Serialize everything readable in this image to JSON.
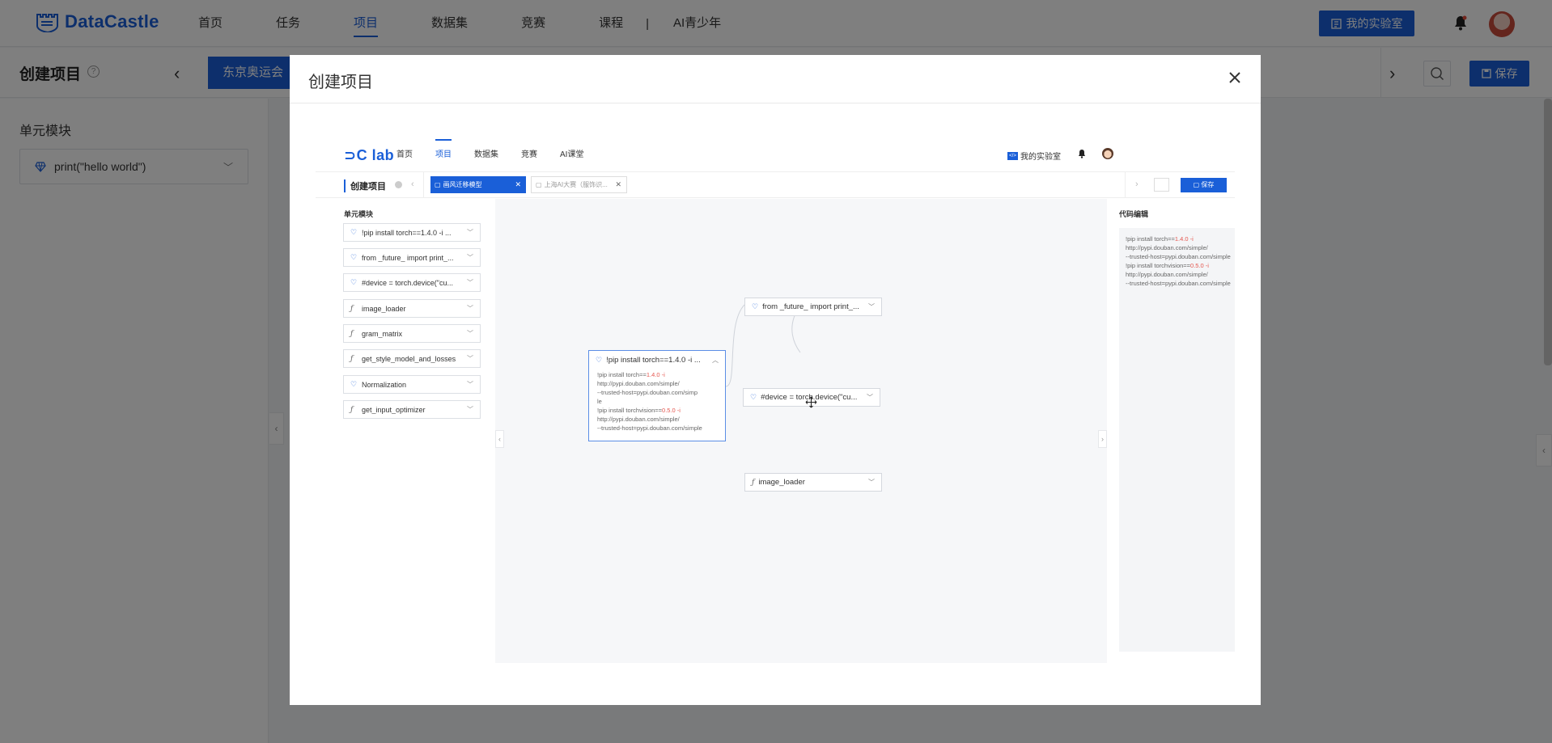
{
  "app": {
    "logo": "DataCastle",
    "nav": [
      "首页",
      "任务",
      "项目",
      "数据集",
      "竞赛",
      "课程"
    ],
    "nav_active": "项目",
    "nav_separator": "|",
    "nav_extra": "AI青少年",
    "lab_button": "我的实验室"
  },
  "subbar": {
    "title": "创建项目",
    "help": "?",
    "tab_label": "东京奥运会",
    "save_label": "保存"
  },
  "left_panel": {
    "label": "单元模块",
    "module": "print(\"hello world\")"
  },
  "modal": {
    "title": "创建项目",
    "preview": {
      "logo": "lab",
      "nav": [
        "首页",
        "项目",
        "数据集",
        "竞赛",
        "AI课堂"
      ],
      "nav_active": "项目",
      "lab_label": "我的实验室",
      "sub_title": "创建项目",
      "tab1": "画风迁移模型",
      "tab2": "上海AI大赛（服饰识...",
      "save_label": "保存",
      "modules_label": "单元模块",
      "modules": [
        {
          "icon": "gem",
          "name": "!pip install torch==1.4.0 -i ..."
        },
        {
          "icon": "gem",
          "name": "from _future_ import print_..."
        },
        {
          "icon": "gem",
          "name": "#device = torch.device(\"cu..."
        },
        {
          "icon": "f",
          "name": "image_loader"
        },
        {
          "icon": "f",
          "name": "gram_matrix"
        },
        {
          "icon": "f",
          "name": "get_style_model_and_losses"
        },
        {
          "icon": "gem",
          "name": "Normalization"
        },
        {
          "icon": "f",
          "name": "get_input_optimizer"
        }
      ],
      "canvas_nodes": {
        "expanded_title": "!pip install torch==1.4.0 -i ...",
        "expanded_lines": [
          [
            "!pip install torch==",
            "1.4.0 -i",
            ""
          ],
          [
            "http://pypi.douban.com/simple/",
            "",
            ""
          ],
          [
            "--trusted-host=pypi.douban.com/simp",
            "",
            ""
          ],
          [
            "le",
            "",
            ""
          ],
          [
            "!pip install torchvision==",
            "0.5.0 -i",
            ""
          ],
          [
            "http://pypi.douban.com/simple/",
            "",
            ""
          ],
          [
            "--trusted-host=pypi.douban.com/simple",
            "",
            ""
          ]
        ],
        "node_future": "from _future_ import print_...",
        "node_device": "#device = torch.device(\"cu...",
        "node_image_loader": "image_loader"
      },
      "code_label": "代码编辑",
      "code_lines": [
        [
          "!pip install torch==",
          "1.4.0 -i"
        ],
        [
          "http://pypi.douban.com/simple/",
          ""
        ],
        [
          "--trusted-host=pypi.douban.com/simple",
          ""
        ],
        [
          "!pip install torchvision==",
          "0.5.0 -i"
        ],
        [
          "http://pypi.douban.com/simple/",
          ""
        ],
        [
          "--trusted-host=pypi.douban.com/simple",
          ""
        ]
      ]
    }
  },
  "colors": {
    "brand": "#1a5fd8",
    "overlay": "rgba(0,0,0,0.5)",
    "code_highlight": "#e5574f"
  }
}
